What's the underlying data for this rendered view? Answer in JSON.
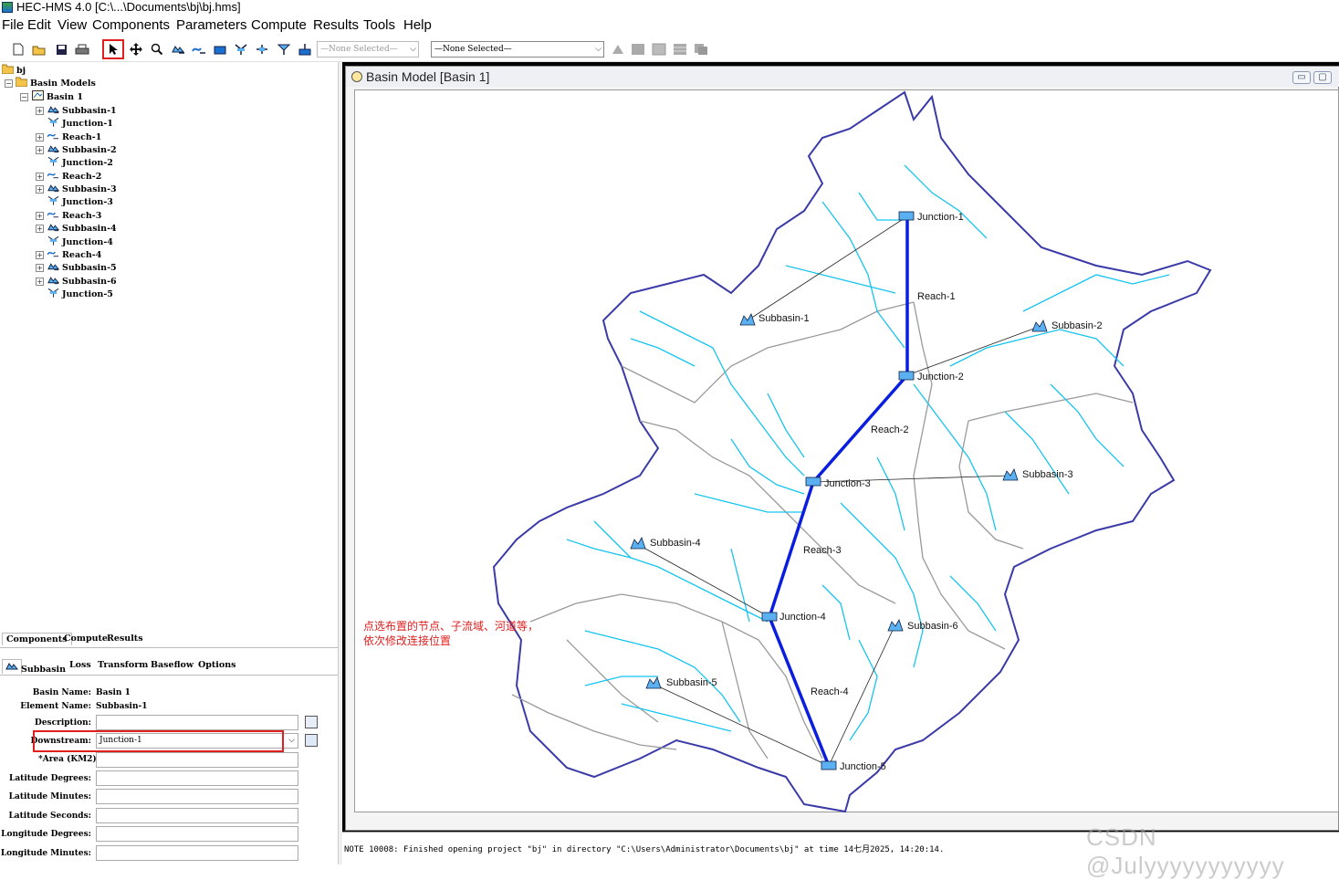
{
  "window": {
    "title": "HEC-HMS 4.0 [C:\\...\\Documents\\bj\\bj.hms]"
  },
  "menu": [
    "File",
    "Edit",
    "View",
    "Components",
    "Parameters",
    "Compute",
    "Results",
    "Tools",
    "Help"
  ],
  "toolbar": {
    "combo1": "—None Selected—",
    "combo2": "—None Selected—"
  },
  "tree": {
    "root": "bj",
    "basin_models": "Basin Models",
    "basin": "Basin 1",
    "items": [
      {
        "label": "Subbasin-1",
        "kind": "subbasin"
      },
      {
        "label": "Junction-1",
        "kind": "junction"
      },
      {
        "label": "Reach-1",
        "kind": "reach"
      },
      {
        "label": "Subbasin-2",
        "kind": "subbasin"
      },
      {
        "label": "Junction-2",
        "kind": "junction"
      },
      {
        "label": "Reach-2",
        "kind": "reach"
      },
      {
        "label": "Subbasin-3",
        "kind": "subbasin"
      },
      {
        "label": "Junction-3",
        "kind": "junction"
      },
      {
        "label": "Reach-3",
        "kind": "reach"
      },
      {
        "label": "Subbasin-4",
        "kind": "subbasin"
      },
      {
        "label": "Junction-4",
        "kind": "junction"
      },
      {
        "label": "Reach-4",
        "kind": "reach"
      },
      {
        "label": "Subbasin-5",
        "kind": "subbasin"
      },
      {
        "label": "Subbasin-6",
        "kind": "subbasin"
      },
      {
        "label": "Junction-5",
        "kind": "junction"
      }
    ]
  },
  "bottom_tabs": [
    "Components",
    "Compute",
    "Results"
  ],
  "editor_tabs": [
    "Subbasin",
    "Loss",
    "Transform",
    "Baseflow",
    "Options"
  ],
  "editor": {
    "basin_name_label": "Basin Name:",
    "basin_name": "Basin 1",
    "element_name_label": "Element Name:",
    "element_name": "Subbasin-1",
    "description_label": "Description:",
    "description": "",
    "downstream_label": "Downstream:",
    "downstream": "Junction-1",
    "area_label": "*Area (KM2)",
    "lat_deg_label": "Latitude Degrees:",
    "lat_min_label": "Latitude Minutes:",
    "lat_sec_label": "Latitude Seconds:",
    "lon_deg_label": "Longitude Degrees:",
    "lon_min_label": "Longitude Minutes:"
  },
  "basin_window": {
    "title": "Basin Model [Basin 1]"
  },
  "map": {
    "junctions": [
      "Junction-1",
      "Junction-2",
      "Junction-3",
      "Junction-4",
      "Junction-5"
    ],
    "reaches": [
      "Reach-1",
      "Reach-2",
      "Reach-3",
      "Reach-4"
    ],
    "subbasins": [
      "Subbasin-1",
      "Subbasin-2",
      "Subbasin-3",
      "Subbasin-4",
      "Subbasin-5",
      "Subbasin-6"
    ],
    "annotation_line1": "点选布置的节点、子流域、河道等，",
    "annotation_line2": "依次修改连接位置"
  },
  "status": {
    "message": "NOTE 10008:  Finished opening project \"bj\" in directory \"C:\\Users\\Administrator\\Documents\\bj\" at time 14七月2025, 14:20:14."
  },
  "watermark": "CSDN @Julyyyyyyyyyyy",
  "colors": {
    "reach": "#0a1ee0",
    "river": "#16c3f0",
    "boundary": "#3a3aa8",
    "subbasin_border": "#9a9a9a",
    "annotation": "#e02020",
    "highlight_box": "#e0201e"
  }
}
